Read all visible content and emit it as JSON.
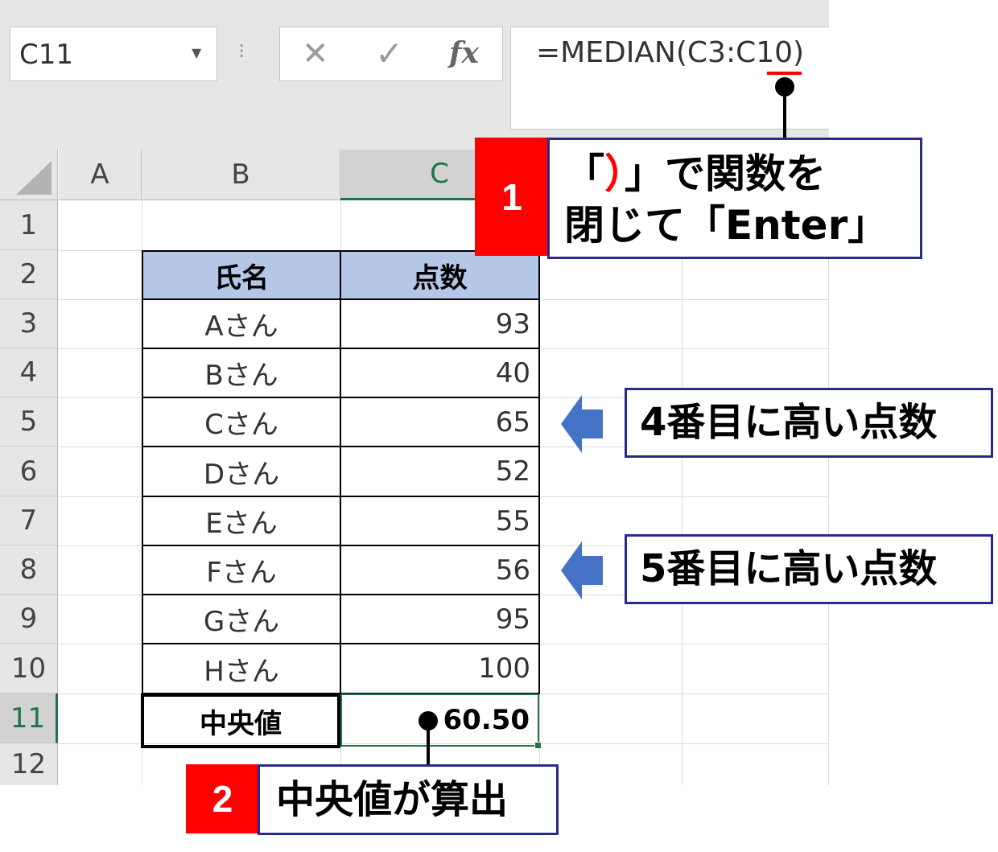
{
  "namebox": {
    "value": "C11",
    "dropdown_icon": "chevron-down-icon"
  },
  "formula_bar": {
    "dots": "⁝",
    "cancel": "✕",
    "enter": "✓",
    "fx": "fx",
    "formula": "=MEDIAN(C3:C10)"
  },
  "columns": [
    "A",
    "B",
    "C"
  ],
  "rows": [
    "1",
    "2",
    "3",
    "4",
    "5",
    "6",
    "7",
    "8",
    "9",
    "10",
    "11",
    "12"
  ],
  "table": {
    "headers": [
      "氏名",
      "点数"
    ],
    "rows": [
      {
        "name": "Aさん",
        "score": "93"
      },
      {
        "name": "Bさん",
        "score": "40"
      },
      {
        "name": "Cさん",
        "score": "65"
      },
      {
        "name": "Dさん",
        "score": "52"
      },
      {
        "name": "Eさん",
        "score": "55"
      },
      {
        "name": "Fさん",
        "score": "56"
      },
      {
        "name": "Gさん",
        "score": "95"
      },
      {
        "name": "Hさん",
        "score": "100"
      }
    ],
    "result_label": "中央値",
    "result_value": "60.50"
  },
  "callouts": {
    "step1_number": "1",
    "step1_line1_prefix": "「",
    "step1_line1_paren": "）",
    "step1_line1_suffix": "」で関数を",
    "step1_line2": "閉じて「Enter」",
    "note_4th": "4番目に高い点数",
    "note_5th": "5番目に高い点数",
    "step2_number": "2",
    "step2_text": "中央値が算出"
  },
  "colors": {
    "header_fill": "#b4c7e7",
    "callout_border": "#2a2a8c",
    "accent_red": "#ff0000",
    "arrow_blue": "#4472c4",
    "selection_green": "#217346"
  }
}
